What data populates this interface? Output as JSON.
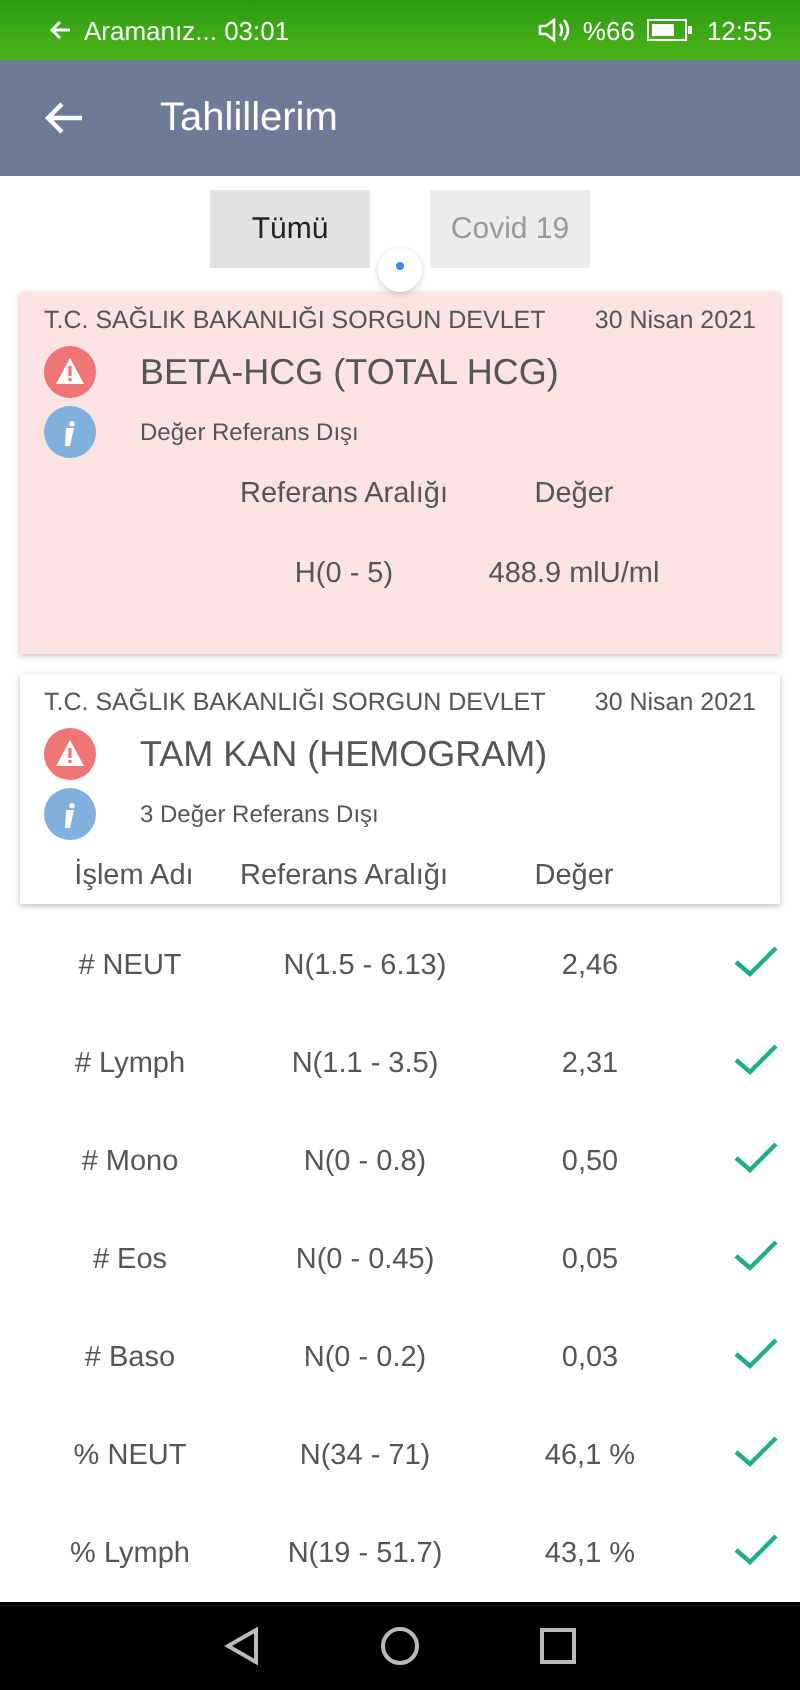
{
  "status_bar": {
    "call": "Aramanız... 03:01",
    "battery_percent": "%66",
    "time": "12:55"
  },
  "app_bar": {
    "title": "Tahlillerim"
  },
  "tabs": [
    {
      "label": "Tümü",
      "selected": true
    },
    {
      "label": "Covid 19",
      "selected": false
    }
  ],
  "loading": true,
  "results": [
    {
      "institution": "T.C. SAĞLIK BAKANLIĞI SORGUN DEVLET",
      "date": "30 Nisan 2021",
      "test": "BETA-HCG (TOTAL HCG)",
      "note": "Değer Referans Dışı",
      "out_of_range": true,
      "columns": [
        "Referans Aralığı",
        "Değer"
      ],
      "rows": [
        {
          "reference": "H(0 - 5)",
          "value": "488.9 mlU/ml"
        }
      ]
    },
    {
      "institution": "T.C. SAĞLIK BAKANLIĞI SORGUN DEVLET",
      "date": "30 Nisan 2021",
      "test": "TAM KAN (HEMOGRAM)",
      "note": "3 Değer Referans Dışı",
      "out_of_range": false,
      "columns": [
        "İşlem Adı",
        "Referans Aralığı",
        "Değer"
      ]
    }
  ],
  "items": [
    {
      "name": "# NEUT",
      "reference": "N(1.5 - 6.13)",
      "value": "2,46",
      "normal": true
    },
    {
      "name": "# Lymph",
      "reference": "N(1.1 - 3.5)",
      "value": "2,31",
      "normal": true
    },
    {
      "name": "# Mono",
      "reference": "N(0 - 0.8)",
      "value": "0,50",
      "normal": true
    },
    {
      "name": "# Eos",
      "reference": "N(0 - 0.45)",
      "value": "0,05",
      "normal": true
    },
    {
      "name": "# Baso",
      "reference": "N(0 - 0.2)",
      "value": "0,03",
      "normal": true
    },
    {
      "name": "% NEUT",
      "reference": "N(34 - 71)",
      "value": "46,1 %",
      "normal": true
    },
    {
      "name": "% Lymph",
      "reference": "N(19 - 51.7)",
      "value": "43,1 %",
      "normal": true
    }
  ]
}
